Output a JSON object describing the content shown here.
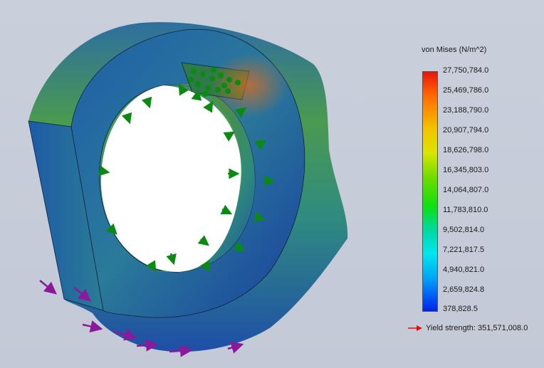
{
  "legend": {
    "title": "von Mises (N/m^2)",
    "ticks": [
      "27,750,784.0",
      "25,469,786.0",
      "23,188,790.0",
      "20,907,794.0",
      "18,626,798.0",
      "16,345,803.0",
      "14,064,807.0",
      "11,783,810.0",
      "9,502,814.0",
      "7,221,817.5",
      "4,940,821.0",
      "2,659,824.8",
      "378,828.5"
    ],
    "yield_label": "Yield strength: 351,571,008.0",
    "yield_color": "#e01010"
  },
  "colors": {
    "background": "#c6ccd8",
    "load_arrows": "#0a8a10",
    "fixture_arrows": "#8a1a9a",
    "low_stress": "#1f56a8",
    "mid_stress": "#3aa060",
    "high_stress": "#d86020"
  }
}
